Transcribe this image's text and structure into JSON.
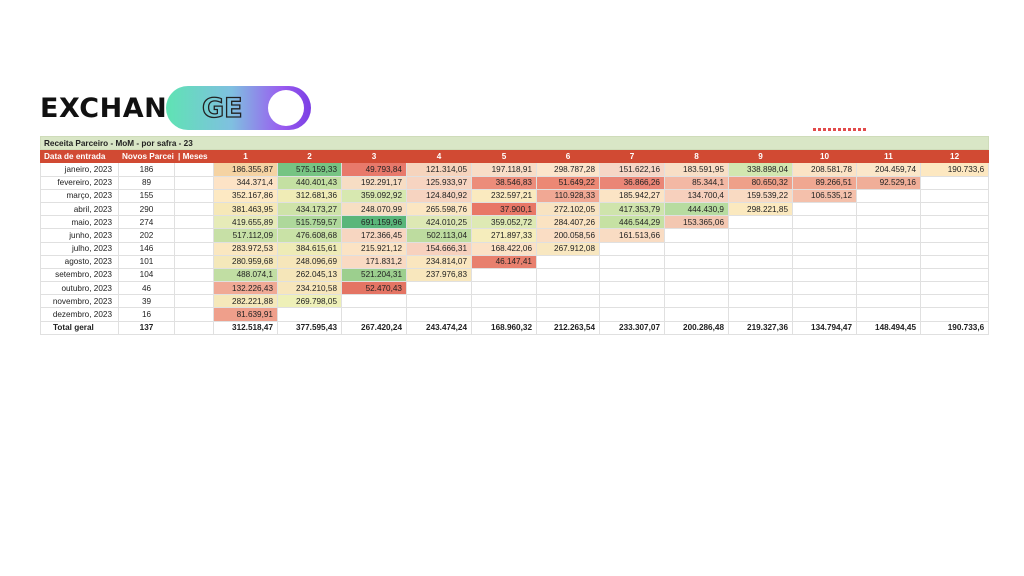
{
  "logo": {
    "text": "EXCHANGE",
    "prefix": "EXCHAN",
    "suffix": "GE"
  },
  "table": {
    "title": "Receita Parceiro - MoM - por safra - 23",
    "headers": [
      "Data de entrada",
      "Novos Parceiros",
      "| Meses",
      "1",
      "2",
      "3",
      "4",
      "5",
      "6",
      "7",
      "8",
      "9",
      "10",
      "11",
      "12"
    ],
    "rows": [
      {
        "label": "janeiro, 2023",
        "novos": "186",
        "values": [
          "186.355,87",
          "575.159,33",
          "49.793,84",
          "121.314,05",
          "197.118,91",
          "298.787,28",
          "151.622,16",
          "183.591,95",
          "338.898,04",
          "208.581,78",
          "204.459,74",
          "190.733,6"
        ]
      },
      {
        "label": "fevereiro, 2023",
        "novos": "89",
        "values": [
          "344.371,4",
          "440.401,43",
          "192.291,17",
          "125.933,97",
          "38.546,83",
          "51.649,22",
          "36.866,26",
          "85.344,1",
          "80.650,32",
          "89.266,51",
          "92.529,16"
        ]
      },
      {
        "label": "março, 2023",
        "novos": "155",
        "values": [
          "352.167,86",
          "312.681,36",
          "359.092,92",
          "124.840,92",
          "232.597,21",
          "110.928,33",
          "185.942,27",
          "134.700,4",
          "159.539,22",
          "106.535,12"
        ]
      },
      {
        "label": "abril, 2023",
        "novos": "290",
        "values": [
          "381.463,95",
          "434.173,27",
          "248.070,99",
          "265.598,76",
          "37.900,1",
          "272.102,05",
          "417.353,79",
          "444.430,9",
          "298.221,85"
        ]
      },
      {
        "label": "maio, 2023",
        "novos": "274",
        "values": [
          "419.655,89",
          "515.759,57",
          "691.159,96",
          "424.010,25",
          "359.052,72",
          "284.407,26",
          "446.544,29",
          "153.365,06"
        ]
      },
      {
        "label": "junho, 2023",
        "novos": "202",
        "values": [
          "517.112,09",
          "476.608,68",
          "172.366,45",
          "502.113,04",
          "271.897,33",
          "200.058,56",
          "161.513,66"
        ]
      },
      {
        "label": "julho, 2023",
        "novos": "146",
        "values": [
          "283.972,53",
          "384.615,61",
          "215.921,12",
          "154.666,31",
          "168.422,06",
          "267.912,08"
        ]
      },
      {
        "label": "agosto, 2023",
        "novos": "101",
        "values": [
          "280.959,68",
          "248.096,69",
          "171.831,2",
          "234.814,07",
          "46.147,41"
        ]
      },
      {
        "label": "setembro, 2023",
        "novos": "104",
        "values": [
          "488.074,1",
          "262.045,13",
          "521.204,31",
          "237.976,83"
        ]
      },
      {
        "label": "outubro, 2023",
        "novos": "46",
        "values": [
          "132.226,43",
          "234.210,58",
          "52.470,43"
        ]
      },
      {
        "label": "novembro, 2023",
        "novos": "39",
        "values": [
          "282.221,88",
          "269.798,05"
        ]
      },
      {
        "label": "dezembro, 2023",
        "novos": "16",
        "values": [
          "81.639,91"
        ]
      }
    ],
    "colors": [
      [
        "#f5d3a3",
        "#76c483",
        "#e8796b",
        "#f6d4bd",
        "#f8ddc7",
        "#fce5cb",
        "#f6d6c6",
        "#f8dfc6",
        "#d2e7b0",
        "#fbe3c5",
        "#fbe7c9",
        "#fde8c1"
      ],
      [
        "#fde3c6",
        "#c4e0a2",
        "#f7ddc4",
        "#f7d4c1",
        "#ec8c7a",
        "#ec8874",
        "#ea8576",
        "#f3b8a4",
        "#eea089",
        "#f0a791",
        "#f0ae98"
      ],
      [
        "#fde9c3",
        "#f0ecb6",
        "#d7e8b0",
        "#f6d3c0",
        "#faeabf",
        "#f1a894",
        "#fbe4c5",
        "#f7d0bd",
        "#f9dac2",
        "#f4c0ab"
      ],
      [
        "#f6e8b8",
        "#cfe3a9",
        "#f7dfc3",
        "#fbe6c2",
        "#e87767",
        "#f8e3c1",
        "#cfe4ac",
        "#b7dca0",
        "#fbe9bf"
      ],
      [
        "#e6ebb8",
        "#aed89b",
        "#5ab67a",
        "#dde8b4",
        "#dee9b4",
        "#fbe3c2",
        "#c6e1a3",
        "#f3c7b1"
      ],
      [
        "#c7e0a6",
        "#c9e2a6",
        "#f7d6c1",
        "#bddc9f",
        "#f5edbc",
        "#faddc4",
        "#f9dcc3"
      ],
      [
        "#fae7c0",
        "#eeebb6",
        "#fbe3c4",
        "#f7d1be",
        "#fbe1c6",
        "#f8e7c0"
      ],
      [
        "#f4e8ba",
        "#f6e6ba",
        "#f9dac3",
        "#fae6bf",
        "#e8806e"
      ],
      [
        "#c1dea3",
        "#f5e6b9",
        "#9ccf8e",
        "#f8e7bd"
      ],
      [
        "#f0a995",
        "#f7e6bc",
        "#e47464"
      ],
      [
        "#f5e8ba",
        "#eef0b8"
      ],
      [
        "#ef9f8b"
      ]
    ],
    "total": {
      "label": "Total geral",
      "novos": "137",
      "values": [
        "312.518,47",
        "377.595,43",
        "267.420,24",
        "243.474,24",
        "168.960,32",
        "212.263,54",
        "233.307,07",
        "200.286,48",
        "219.327,36",
        "134.794,47",
        "148.494,45",
        "190.733,6"
      ]
    }
  }
}
